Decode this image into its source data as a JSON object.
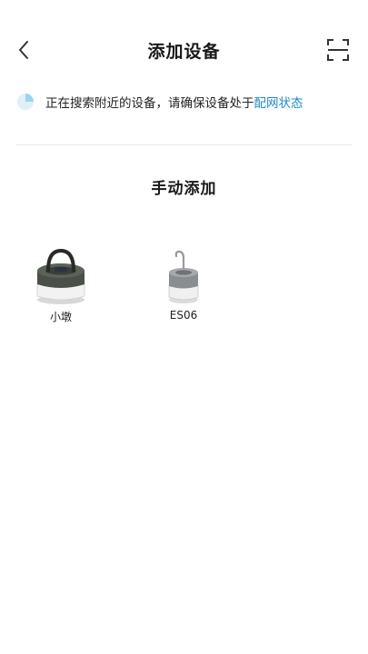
{
  "header": {
    "title": "添加设备",
    "back_icon": "chevron-left-icon",
    "scan_icon": "scan-frame-icon"
  },
  "status": {
    "text": "正在搜索附近的设备，请确保设备处于",
    "link": "配网状态",
    "link_color": "#1a8cc8",
    "spinner_color": "#bfe3f5"
  },
  "section": {
    "title": "手动添加"
  },
  "devices": [
    {
      "label": "小墩",
      "icon": "lantern-dark-icon"
    },
    {
      "label": "ES06",
      "icon": "lantern-hook-icon"
    }
  ]
}
